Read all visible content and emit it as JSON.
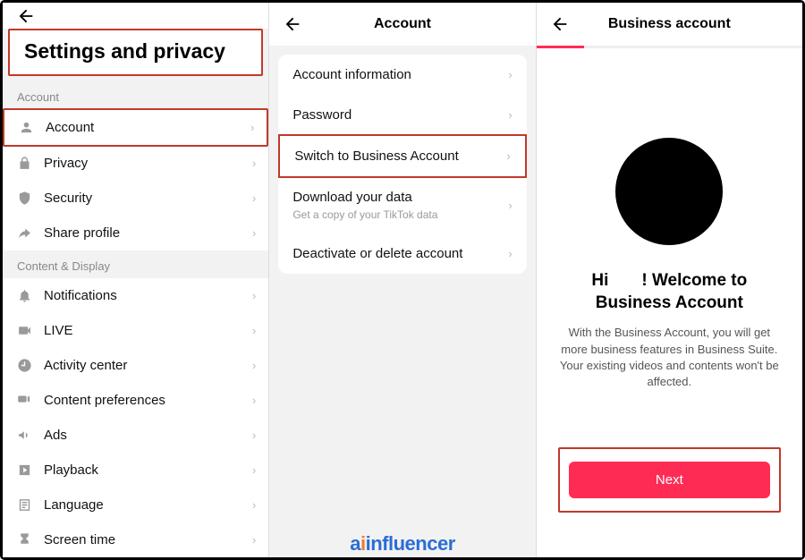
{
  "panel1": {
    "title": "Settings and privacy",
    "sections": [
      {
        "label": "Account",
        "items": [
          {
            "icon": "person",
            "label": "Account",
            "hl": true
          },
          {
            "icon": "lock",
            "label": "Privacy"
          },
          {
            "icon": "shield",
            "label": "Security"
          },
          {
            "icon": "share",
            "label": "Share profile"
          }
        ]
      },
      {
        "label": "Content & Display",
        "items": [
          {
            "icon": "bell",
            "label": "Notifications"
          },
          {
            "icon": "live",
            "label": "LIVE"
          },
          {
            "icon": "clock",
            "label": "Activity center"
          },
          {
            "icon": "video",
            "label": "Content preferences"
          },
          {
            "icon": "megaphone",
            "label": "Ads"
          },
          {
            "icon": "play",
            "label": "Playback"
          },
          {
            "icon": "lang",
            "label": "Language"
          },
          {
            "icon": "hourglass",
            "label": "Screen time"
          }
        ]
      }
    ]
  },
  "panel2": {
    "title": "Account",
    "items": [
      {
        "label": "Account information"
      },
      {
        "label": "Password"
      },
      {
        "label": "Switch to Business Account",
        "hl": true
      },
      {
        "label": "Download your data",
        "sub": "Get a copy of your TikTok data"
      },
      {
        "label": "Deactivate or delete account"
      }
    ]
  },
  "panel3": {
    "title": "Business account",
    "welcome_prefix": "Hi",
    "welcome_suffix": "! Welcome to Business Account",
    "desc": "With the Business Account, you will get more business features in Business Suite. Your existing videos and contents won't be affected.",
    "next": "Next"
  },
  "watermark": {
    "a": "a",
    "i": "i",
    "rest": "influencer"
  }
}
